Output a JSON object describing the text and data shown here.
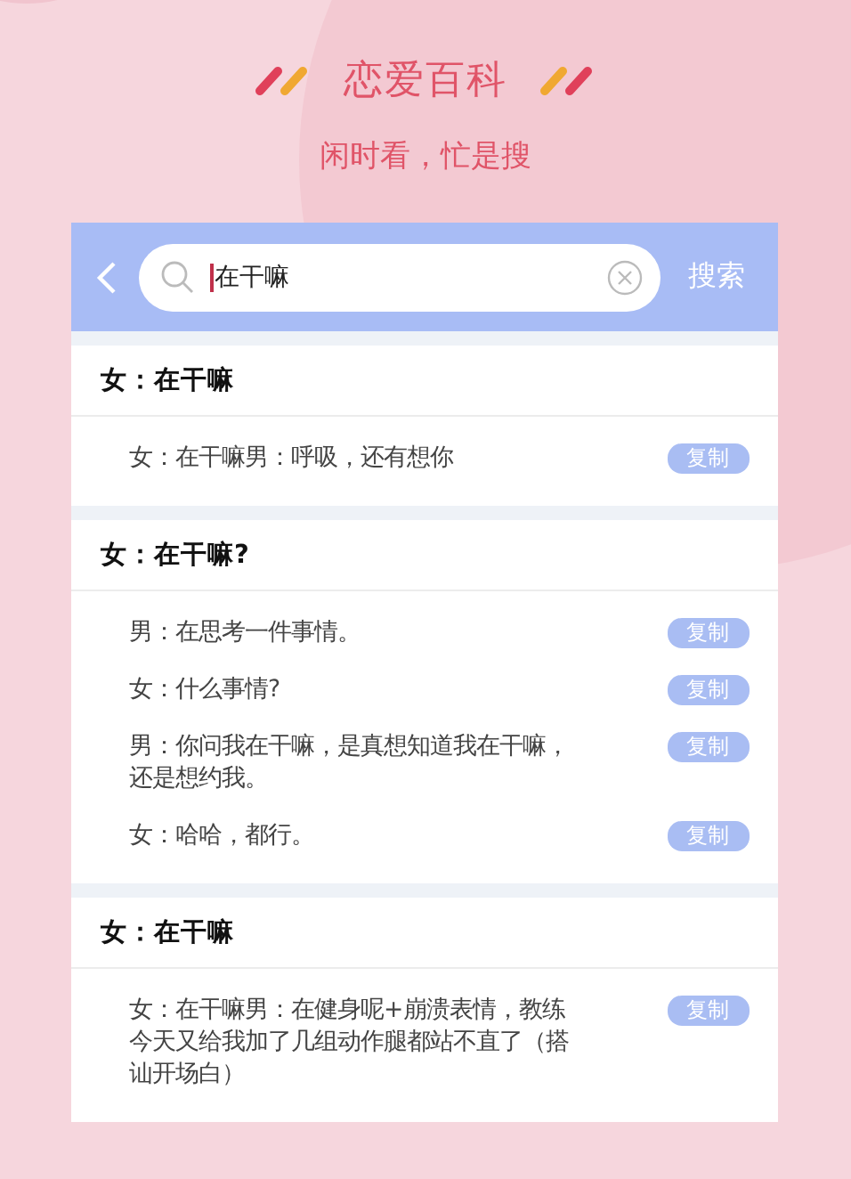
{
  "header": {
    "title": "恋爱百科",
    "subtitle": "闲时看，忙是搜"
  },
  "search": {
    "value": "在干嘛",
    "action": "搜索"
  },
  "groups": [
    {
      "title": "女：在干嘛",
      "items": [
        {
          "text": "女：在干嘛男：呼吸，还有想你",
          "button": "复制"
        }
      ]
    },
    {
      "title": "女：在干嘛?",
      "items": [
        {
          "text": "男：在思考一件事情。",
          "button": "复制"
        },
        {
          "text": "女：什么事情?",
          "button": "复制"
        },
        {
          "text": "男：你问我在干嘛，是真想知道我在干嘛，还是想约我。",
          "button": "复制"
        },
        {
          "text": "女：哈哈，都行。",
          "button": "复制"
        }
      ]
    },
    {
      "title": "女：在干嘛",
      "items": [
        {
          "text": "女：在干嘛男：在健身呢+崩溃表情，教练今天又给我加了几组动作腿都站不直了（搭讪开场白）",
          "button": "复制"
        }
      ]
    }
  ]
}
